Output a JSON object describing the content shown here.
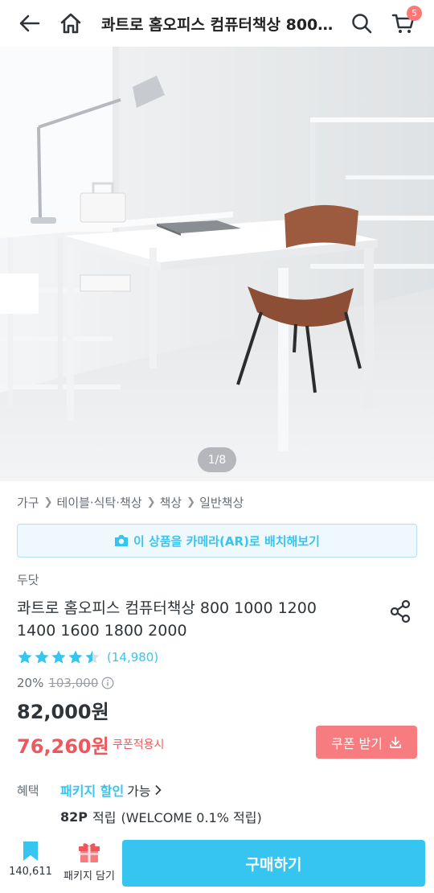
{
  "header": {
    "title": "콰트로 홈오피스 컴퓨터책상 800 1000 1200 1400 1600 1800 2000",
    "cart_count": "5",
    "icons": [
      "back-arrow-icon",
      "home-icon",
      "search-icon",
      "cart-icon"
    ]
  },
  "hero": {
    "counter": "1/8"
  },
  "breadcrumb": [
    "가구",
    "테이블·식탁·책상",
    "책상",
    "일반책상"
  ],
  "ar_button": "이 상품을 카메라(AR)로 배치해보기",
  "product": {
    "brand": "두닷",
    "title": "콰트로 홈오피스 컴퓨터책상 800 1000 1200 1400 1600 1800 2000",
    "rating": 4.5,
    "review_count": "(14,980)",
    "discount": "20%",
    "original_price": "103,000",
    "price": "82,000원",
    "coupon_price": "76,260원",
    "coupon_note": "쿠폰적용시",
    "coupon_button": "쿠폰 받기"
  },
  "benefits": {
    "label": "혜택",
    "package_link": "패키지 할인",
    "package_available": "가능",
    "points": "82P",
    "points_label": "적립",
    "points_detail": "(WELCOME 0.1% 적립)"
  },
  "bottom_bar": {
    "scrap_count": "140,611",
    "package_label": "패키지 담기",
    "buy_label": "구매하기"
  },
  "colors": {
    "accent": "#35c5f0",
    "coupon": "#f0575c",
    "coupon_button": "#f77c80"
  }
}
